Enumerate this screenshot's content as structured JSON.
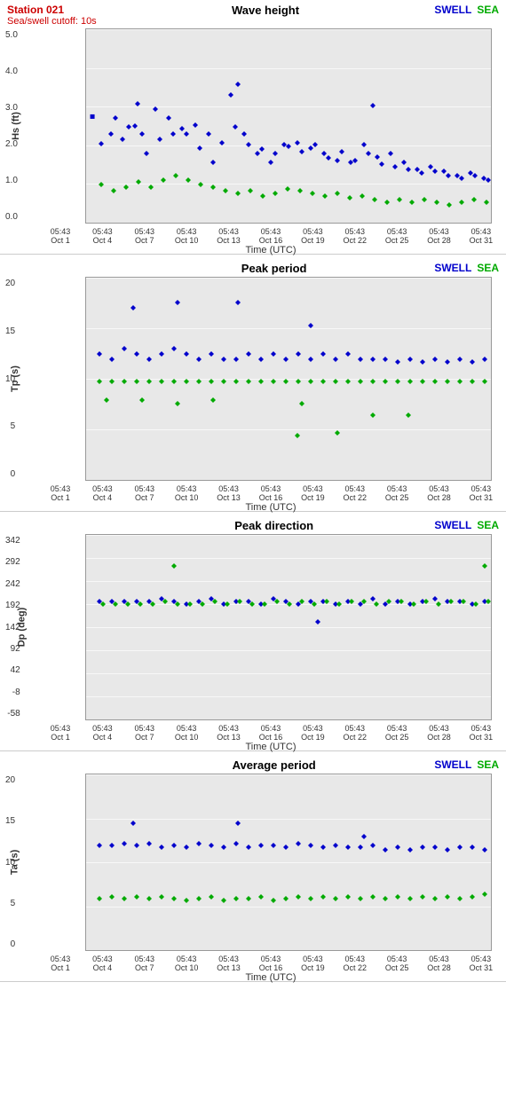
{
  "charts": [
    {
      "id": "wave-height",
      "title": "Wave height",
      "ylabel": "Hs (ft)",
      "yticks": [
        "5.0",
        "4.0",
        "3.0",
        "2.0",
        "1.0",
        "0.0"
      ],
      "ymin": 0,
      "ymax": 5.0,
      "show_station": true
    },
    {
      "id": "peak-period",
      "title": "Peak period",
      "ylabel": "Tp (s)",
      "yticks": [
        "20",
        "15",
        "10",
        "5",
        "0"
      ],
      "ymin": 0,
      "ymax": 22,
      "show_station": false
    },
    {
      "id": "peak-direction",
      "title": "Peak direction",
      "ylabel": "Dp (deg)",
      "yticks": [
        "342",
        "292",
        "242",
        "192",
        "142",
        "92",
        "42",
        "-8",
        "-58"
      ],
      "ymin": -58,
      "ymax": 342,
      "show_station": false
    },
    {
      "id": "avg-period",
      "title": "Average period",
      "ylabel": "Ta (s)",
      "yticks": [
        "20",
        "15",
        "10",
        "5",
        "0"
      ],
      "ymin": 0,
      "ymax": 20,
      "show_station": false
    }
  ],
  "station": {
    "name": "Station 021",
    "cutoff": "Sea/swell cutoff: 10s"
  },
  "legend": {
    "swell": "SWELL",
    "sea": "SEA"
  },
  "x_labels": [
    {
      "time": "05:43",
      "date": "Oct 1"
    },
    {
      "time": "05:43",
      "date": "Oct 4"
    },
    {
      "time": "05:43",
      "date": "Oct 7"
    },
    {
      "time": "05:43",
      "date": "Oct 10"
    },
    {
      "time": "05:43",
      "date": "Oct 13"
    },
    {
      "time": "05:43",
      "date": "Oct 16"
    },
    {
      "time": "05:43",
      "date": "Oct 19"
    },
    {
      "time": "05:43",
      "date": "Oct 22"
    },
    {
      "time": "05:43",
      "date": "Oct 25"
    },
    {
      "time": "05:43",
      "date": "Oct 28"
    },
    {
      "time": "05:43",
      "date": "Oct 31"
    }
  ],
  "x_axis_title": "Time (UTC)"
}
